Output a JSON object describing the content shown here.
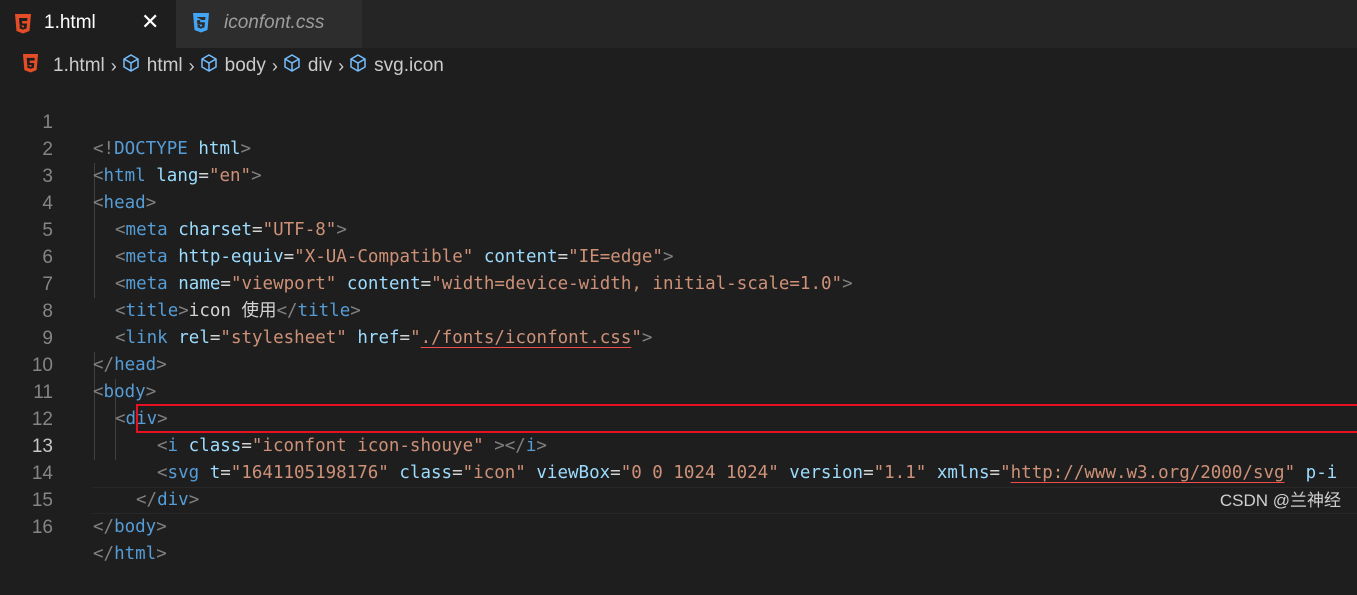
{
  "tabs": [
    {
      "label": "1.html",
      "icon": "html5-icon",
      "active": true,
      "close": "✕"
    },
    {
      "label": "iconfont.css",
      "icon": "css3-icon",
      "active": false
    }
  ],
  "breadcrumb": [
    {
      "label": "1.html",
      "icon": "html5-icon"
    },
    {
      "label": "html",
      "icon": "cube-icon"
    },
    {
      "label": "body",
      "icon": "cube-icon"
    },
    {
      "label": "div",
      "icon": "cube-icon"
    },
    {
      "label": "svg.icon",
      "icon": "cube-icon"
    }
  ],
  "editor": {
    "current_line": 13,
    "lines": [
      {
        "n": "1"
      },
      {
        "n": "2"
      },
      {
        "n": "3"
      },
      {
        "n": "4"
      },
      {
        "n": "5"
      },
      {
        "n": "6"
      },
      {
        "n": "7"
      },
      {
        "n": "8"
      },
      {
        "n": "9"
      },
      {
        "n": "10"
      },
      {
        "n": "11"
      },
      {
        "n": "12"
      },
      {
        "n": "13"
      },
      {
        "n": "14"
      },
      {
        "n": "15"
      },
      {
        "n": "16"
      }
    ],
    "code": {
      "l1": {
        "open": "<!",
        "kw": "DOCTYPE",
        "name": "html",
        "close": ">"
      },
      "l2": {
        "open": "<",
        "tag": "html",
        "attr": "lang",
        "eq": "=",
        "val": "\"en\"",
        "close": ">"
      },
      "l3": {
        "open": "<",
        "tag": "head",
        "close": ">"
      },
      "l4": {
        "open": "<",
        "tag": "meta",
        "attr": "charset",
        "eq": "=",
        "val": "\"UTF-8\"",
        "close": ">"
      },
      "l5": {
        "open": "<",
        "tag": "meta",
        "attr1": "http-equiv",
        "val1": "\"X-UA-Compatible\"",
        "attr2": "content",
        "val2": "\"IE=edge\"",
        "close": ">"
      },
      "l6": {
        "open": "<",
        "tag": "meta",
        "attr1": "name",
        "val1": "\"viewport\"",
        "attr2": "content",
        "val2": "\"width=device-width, initial-scale=1.0\"",
        "close": ">"
      },
      "l7": {
        "open": "<",
        "tag": "title",
        "text": "icon 使用",
        "end_open": "</",
        "close": ">"
      },
      "l8": {
        "open": "<",
        "tag": "link",
        "attr1": "rel",
        "val1": "\"stylesheet\"",
        "attr2": "href",
        "q": "\"",
        "link": "./fonts/iconfont.css",
        "close": ">"
      },
      "l9": {
        "open": "</",
        "tag": "head",
        "close": ">"
      },
      "l10": {
        "open": "<",
        "tag": "body",
        "close": ">"
      },
      "l11": {
        "open": "<",
        "tag": "div",
        "close": ">"
      },
      "l12": {
        "open": "<",
        "tag": "i",
        "attr": "class",
        "val": "\"iconfont icon-shouye\"",
        "mid": " ></",
        "close": ">"
      },
      "l13": {
        "open": "<",
        "tag": "svg",
        "attr1": "t",
        "val1": "\"1641105198176\"",
        "attr2": "class",
        "val2": "\"icon\"",
        "attr3": "viewBox",
        "val3": "\"0 0 1024 1024\"",
        "attr4": "version",
        "val4": "\"1.1\"",
        "attr5": "xmlns",
        "q": "\"",
        "link": "http://www.w3.org/2000/svg",
        "attr6": "p-i"
      },
      "l14": {
        "open": "</",
        "tag": "div",
        "close": ">"
      },
      "l15": {
        "open": "</",
        "tag": "body",
        "close": ">"
      },
      "l16": {
        "open": "</",
        "tag": "html",
        "close": ">"
      }
    }
  },
  "watermark": "CSDN @兰神经",
  "colors": {
    "tag": "#569cd6",
    "attribute": "#9cdcfe",
    "string": "#ce9178",
    "punctuation": "#808080",
    "highlight_border": "#e81123",
    "html5_icon": "#e44d26",
    "css3_icon": "#42a5f5"
  }
}
